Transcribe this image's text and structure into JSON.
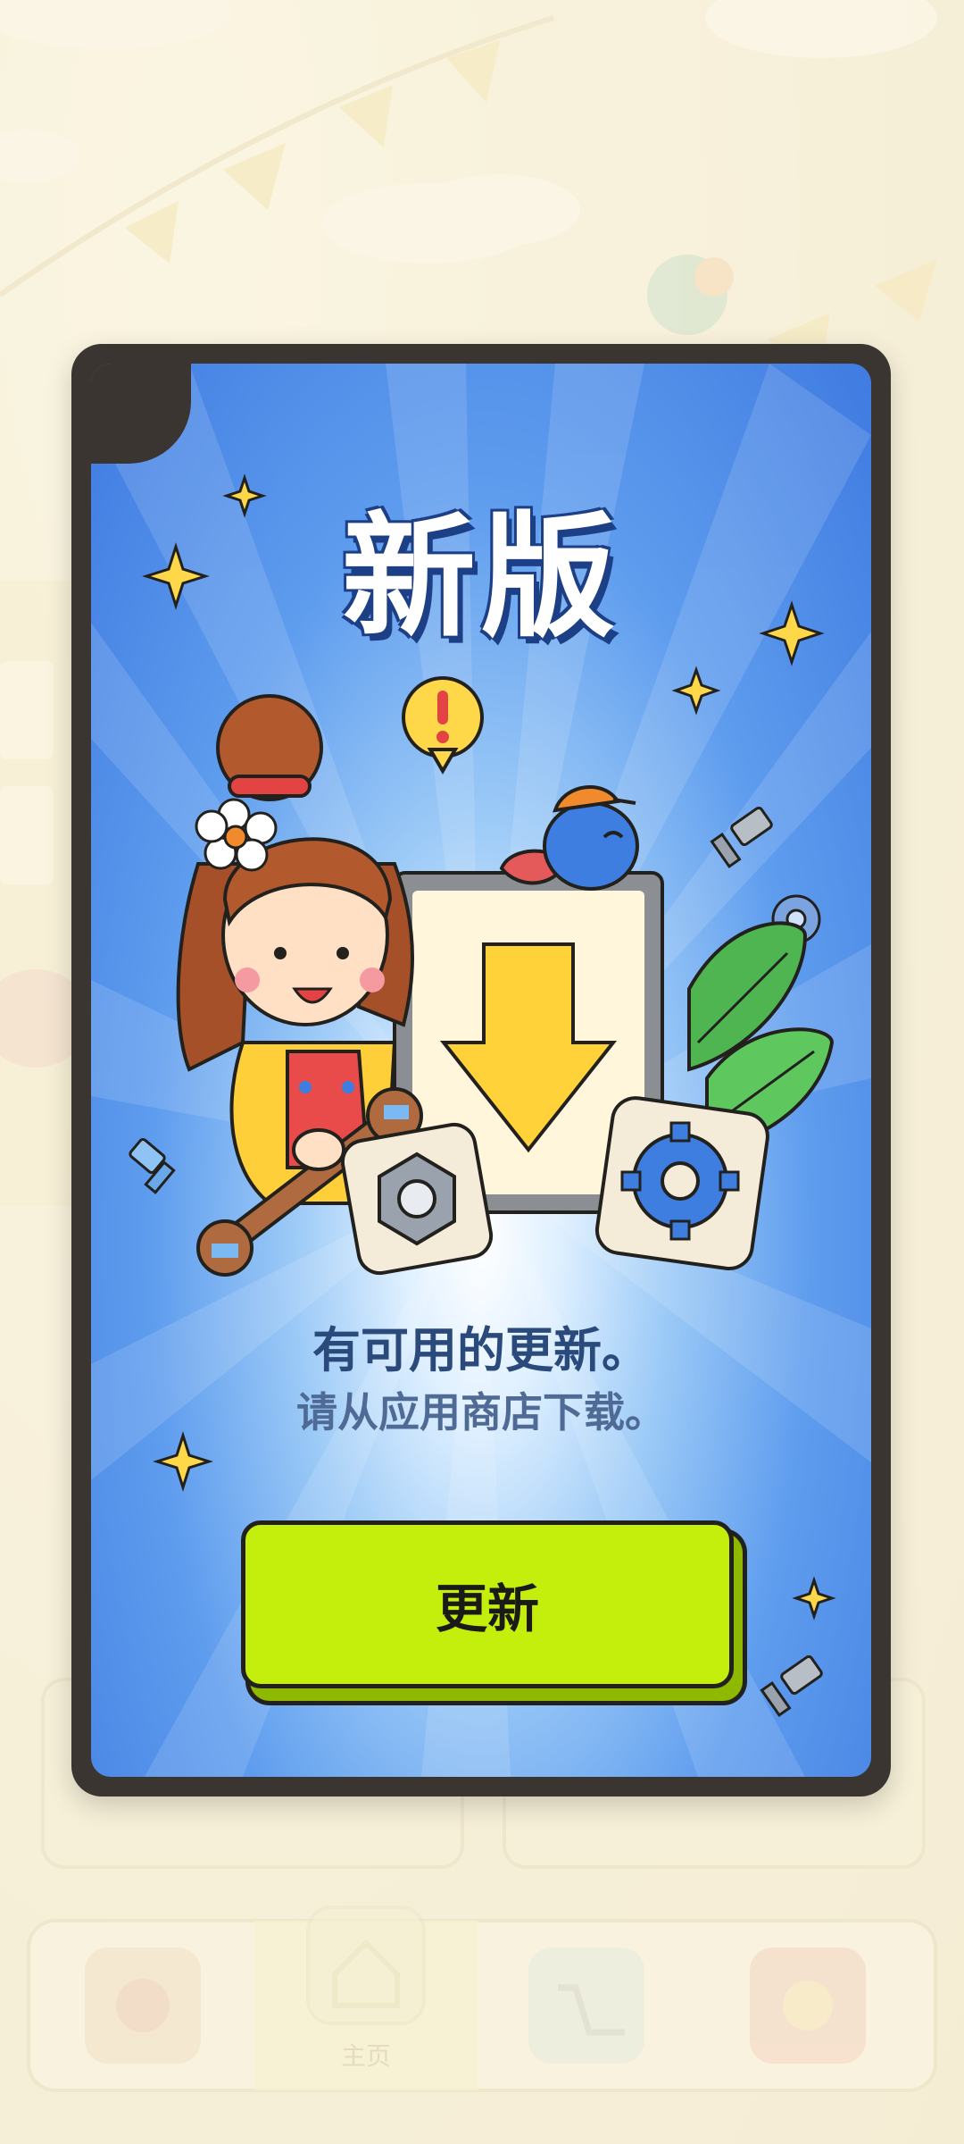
{
  "modal": {
    "title": "新版",
    "message_primary": "有可用的更新。",
    "message_secondary": "请从应用商店下载。",
    "update_button_label": "更新"
  },
  "background": {
    "bottom_nav": {
      "items": [
        {
          "icon": "puzzle-icon"
        },
        {
          "icon": "home-icon",
          "label": "主页"
        },
        {
          "icon": "cart-icon"
        },
        {
          "icon": "gear-puzzle-icon"
        }
      ]
    }
  },
  "colors": {
    "modal_frame": "#3a3530",
    "sky_blue": "#5e9cee",
    "title_outline": "#1d3f86",
    "button_fill": "#c4ef0d",
    "button_shadow": "#8fb800",
    "text_primary": "#2b4a7c"
  }
}
